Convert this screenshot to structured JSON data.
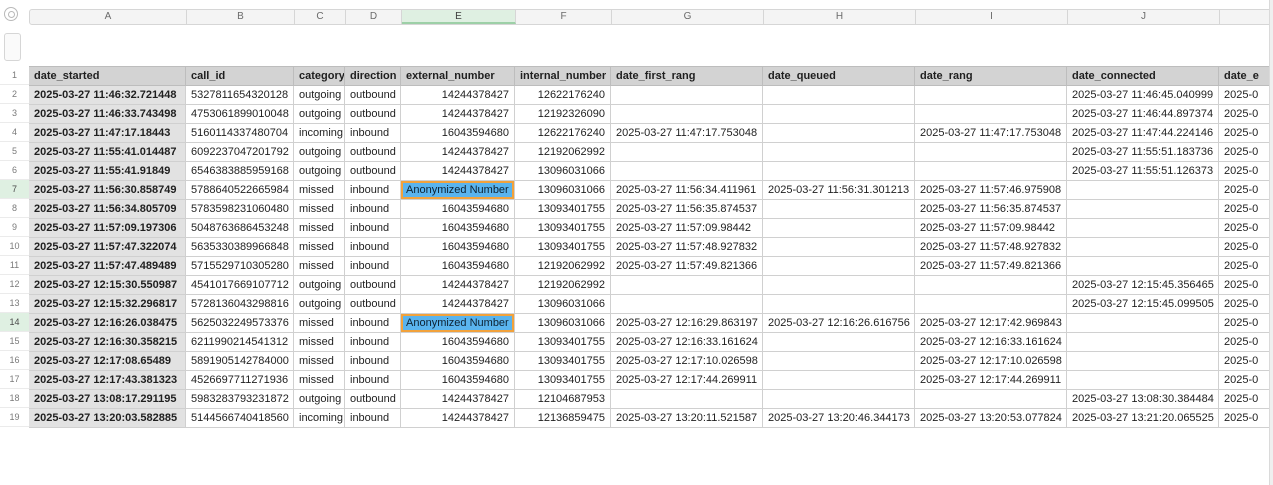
{
  "column_letters": [
    "A",
    "B",
    "C",
    "D",
    "E",
    "F",
    "G",
    "H",
    "I",
    "J",
    ""
  ],
  "active_column": "E",
  "row_numbers": [
    "1",
    "2",
    "3",
    "4",
    "5",
    "6",
    "7",
    "8",
    "9",
    "10",
    "11",
    "12",
    "13",
    "14",
    "15",
    "16",
    "17",
    "18",
    "19"
  ],
  "active_rows": [
    "7",
    "14"
  ],
  "headers": [
    "date_started",
    "call_id",
    "category",
    "direction",
    "external_number",
    "internal_number",
    "date_first_rang",
    "date_queued",
    "date_rang",
    "date_connected",
    "date_e"
  ],
  "rows": [
    [
      "2025-03-27 11:46:32.721448",
      "5327811654320128",
      "outgoing",
      "outbound",
      "14244378427",
      "12622176240",
      "",
      "",
      "",
      "2025-03-27 11:46:45.040999",
      "2025-0"
    ],
    [
      "2025-03-27 11:46:33.743498",
      "4753061899010048",
      "outgoing",
      "outbound",
      "14244378427",
      "12192326090",
      "",
      "",
      "",
      "2025-03-27 11:46:44.897374",
      "2025-0"
    ],
    [
      "2025-03-27 11:47:17.18443",
      "5160114337480704",
      "incoming",
      "inbound",
      "16043594680",
      "12622176240",
      "2025-03-27 11:47:17.753048",
      "",
      "2025-03-27 11:47:17.753048",
      "2025-03-27 11:47:44.224146",
      "2025-0"
    ],
    [
      "2025-03-27 11:55:41.014487",
      "6092237047201792",
      "outgoing",
      "outbound",
      "14244378427",
      "12192062992",
      "",
      "",
      "",
      "2025-03-27 11:55:51.183736",
      "2025-0"
    ],
    [
      "2025-03-27 11:55:41.91849",
      "6546383885959168",
      "outgoing",
      "outbound",
      "14244378427",
      "13096031066",
      "",
      "",
      "",
      "2025-03-27 11:55:51.126373",
      "2025-0"
    ],
    [
      "2025-03-27 11:56:30.858749",
      "5788640522665984",
      "missed",
      "inbound",
      "Anonymized Number",
      "13096031066",
      "2025-03-27 11:56:34.411961",
      "2025-03-27 11:56:31.301213",
      "2025-03-27 11:57:46.975908",
      "",
      "2025-0"
    ],
    [
      "2025-03-27 11:56:34.805709",
      "5783598231060480",
      "missed",
      "inbound",
      "16043594680",
      "13093401755",
      "2025-03-27 11:56:35.874537",
      "",
      "2025-03-27 11:56:35.874537",
      "",
      "2025-0"
    ],
    [
      "2025-03-27 11:57:09.197306",
      "5048763686453248",
      "missed",
      "inbound",
      "16043594680",
      "13093401755",
      "2025-03-27 11:57:09.98442",
      "",
      "2025-03-27 11:57:09.98442",
      "",
      "2025-0"
    ],
    [
      "2025-03-27 11:57:47.322074",
      "5635330389966848",
      "missed",
      "inbound",
      "16043594680",
      "13093401755",
      "2025-03-27 11:57:48.927832",
      "",
      "2025-03-27 11:57:48.927832",
      "",
      "2025-0"
    ],
    [
      "2025-03-27 11:57:47.489489",
      "5715529710305280",
      "missed",
      "inbound",
      "16043594680",
      "12192062992",
      "2025-03-27 11:57:49.821366",
      "",
      "2025-03-27 11:57:49.821366",
      "",
      "2025-0"
    ],
    [
      "2025-03-27 12:15:30.550987",
      "4541017669107712",
      "outgoing",
      "outbound",
      "14244378427",
      "12192062992",
      "",
      "",
      "",
      "2025-03-27 12:15:45.356465",
      "2025-0"
    ],
    [
      "2025-03-27 12:15:32.296817",
      "5728136043298816",
      "outgoing",
      "outbound",
      "14244378427",
      "13096031066",
      "",
      "",
      "",
      "2025-03-27 12:15:45.099505",
      "2025-0"
    ],
    [
      "2025-03-27 12:16:26.038475",
      "5625032249573376",
      "missed",
      "inbound",
      "Anonymized Number",
      "13096031066",
      "2025-03-27 12:16:29.863197",
      "2025-03-27 12:16:26.616756",
      "2025-03-27 12:17:42.969843",
      "",
      "2025-0"
    ],
    [
      "2025-03-27 12:16:30.358215",
      "6211990214541312",
      "missed",
      "inbound",
      "16043594680",
      "13093401755",
      "2025-03-27 12:16:33.161624",
      "",
      "2025-03-27 12:16:33.161624",
      "",
      "2025-0"
    ],
    [
      "2025-03-27 12:17:08.65489",
      "5891905142784000",
      "missed",
      "inbound",
      "16043594680",
      "13093401755",
      "2025-03-27 12:17:10.026598",
      "",
      "2025-03-27 12:17:10.026598",
      "",
      "2025-0"
    ],
    [
      "2025-03-27 12:17:43.381323",
      "4526697711271936",
      "missed",
      "inbound",
      "16043594680",
      "13093401755",
      "2025-03-27 12:17:44.269911",
      "",
      "2025-03-27 12:17:44.269911",
      "",
      "2025-0"
    ],
    [
      "2025-03-27 13:08:17.291195",
      "5983283793231872",
      "outgoing",
      "outbound",
      "14244378427",
      "12104687953",
      "",
      "",
      "",
      "2025-03-27 13:08:30.384484",
      "2025-0"
    ],
    [
      "2025-03-27 13:20:03.582885",
      "5144566740418560",
      "incoming",
      "inbound",
      "14244378427",
      "12136859475",
      "2025-03-27 13:20:11.521587",
      "2025-03-27 13:20:46.344173",
      "2025-03-27 13:20:53.077824",
      "2025-03-27 13:21:20.065525",
      "2025-0"
    ]
  ]
}
